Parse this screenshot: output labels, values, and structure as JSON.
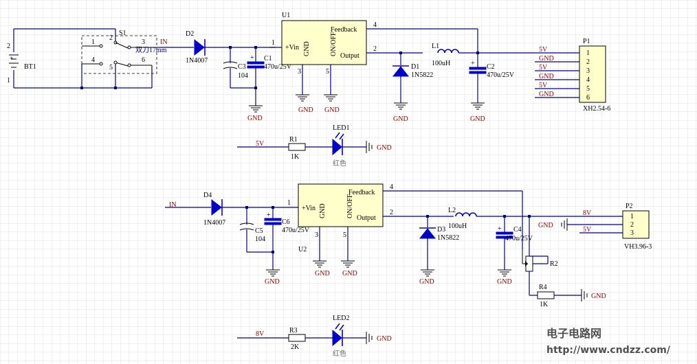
{
  "u1": {
    "ref": "U1",
    "pin_vin": "+Vin",
    "pin_gnd": "GND",
    "pin_onoff": "ON/OFF",
    "pin_feedback": "Feedback",
    "pin_output": "Output",
    "pin1": "1",
    "pin2": "2",
    "pin3": "3",
    "pin4": "4",
    "pin5": "5"
  },
  "u2": {
    "ref": "U2",
    "pin_vin": "+Vin",
    "pin_gnd": "GND",
    "pin_onoff": "ON/OFF",
    "pin_feedback": "Feedback",
    "pin_output": "Output",
    "pin1": "1",
    "pin2": "2",
    "pin3": "3",
    "pin4": "4",
    "pin5": "5"
  },
  "bt1": {
    "ref": "BT1",
    "pin1": "1",
    "pin2": "2"
  },
  "s1": {
    "ref": "S1",
    "desc": "双刀17mm",
    "pins": [
      "1",
      "2",
      "3",
      "4",
      "5",
      "6"
    ]
  },
  "nets": {
    "in": "IN",
    "gnd": "GND",
    "v5": "5V",
    "v8": "8V"
  },
  "d2": {
    "ref": "D2",
    "value": "1N4007"
  },
  "d4": {
    "ref": "D4",
    "value": "1N4007"
  },
  "d1": {
    "ref": "D1",
    "value": "1N5822"
  },
  "d3": {
    "ref": "D3",
    "value": "1N5822"
  },
  "c1": {
    "ref": "C1",
    "value": "470u/25V"
  },
  "c2": {
    "ref": "C2",
    "value": "470u/25V"
  },
  "c3": {
    "ref": "C3",
    "value": "104"
  },
  "c4": {
    "ref": "C4",
    "value": "470u/25V"
  },
  "c5": {
    "ref": "C5",
    "value": "104"
  },
  "c6": {
    "ref": "C6",
    "value": "470u/25V"
  },
  "l1": {
    "ref": "L1",
    "value": "100uH"
  },
  "l2": {
    "ref": "L2",
    "value": "100uH"
  },
  "r1": {
    "ref": "R1",
    "value": "1K"
  },
  "r2": {
    "ref": "R2"
  },
  "r3": {
    "ref": "R3",
    "value": "2K"
  },
  "r4": {
    "ref": "R4",
    "value": "1K"
  },
  "led1": {
    "ref": "LED1",
    "color": "红色"
  },
  "led2": {
    "ref": "LED2",
    "color": "红色"
  },
  "p1": {
    "ref": "P1",
    "part": "XH2.54-6",
    "pins": [
      "1",
      "2",
      "3",
      "4",
      "5",
      "6"
    ],
    "nets": [
      "5V",
      "GND",
      "5V",
      "GND",
      "5V",
      "GND"
    ]
  },
  "p2": {
    "ref": "P2",
    "part": "VH3.96-3",
    "pins": [
      "1",
      "2",
      "3"
    ],
    "nets": [
      "8V",
      "GND",
      "5V"
    ]
  },
  "watermark": {
    "title": "电子电路网",
    "url": "http://www.cndzz.com/"
  },
  "colors": {
    "wire": "#000080",
    "net_label": "#8b0000",
    "component": "#0000c8",
    "grid": "#d8d8d8"
  }
}
